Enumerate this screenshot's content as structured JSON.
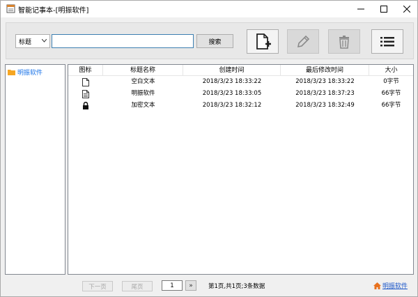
{
  "window": {
    "title": "智能记事本-[明振软件]"
  },
  "toolbar": {
    "filter_selected": "标题",
    "search_value": "",
    "search_placeholder": "",
    "search_label": "搜索",
    "tools": [
      {
        "name": "new-note-icon"
      },
      {
        "name": "edit-icon",
        "disabled": true
      },
      {
        "name": "delete-icon",
        "disabled": true
      },
      {
        "name": "list-icon"
      }
    ]
  },
  "tree": {
    "items": [
      {
        "label": "明振软件"
      }
    ]
  },
  "list": {
    "columns": [
      "图标",
      "标题名称",
      "创建时间",
      "最后修改时间",
      "大小"
    ],
    "rows": [
      {
        "icon": "blank-file-icon",
        "title": "空白文本",
        "created": "2018/3/23 18:33:22",
        "modified": "2018/3/23 18:33:22",
        "size": "0字节"
      },
      {
        "icon": "text-file-icon",
        "title": "明振软件",
        "created": "2018/3/23 18:33:05",
        "modified": "2018/3/23 18:37:23",
        "size": "66字节"
      },
      {
        "icon": "lock-icon",
        "title": "加密文本",
        "created": "2018/3/23 18:32:12",
        "modified": "2018/3/23 18:32:49",
        "size": "66字节"
      }
    ]
  },
  "pager": {
    "prev_label": "下一页",
    "last_label": "尾页",
    "page_value": "1",
    "go_label": "»",
    "info": "第1页,共1页;3条数据"
  },
  "footer": {
    "home_label": "明振软件"
  },
  "colors": {
    "accent": "#1a73e8",
    "folder": "#f5a623",
    "home": "#e8711e"
  }
}
